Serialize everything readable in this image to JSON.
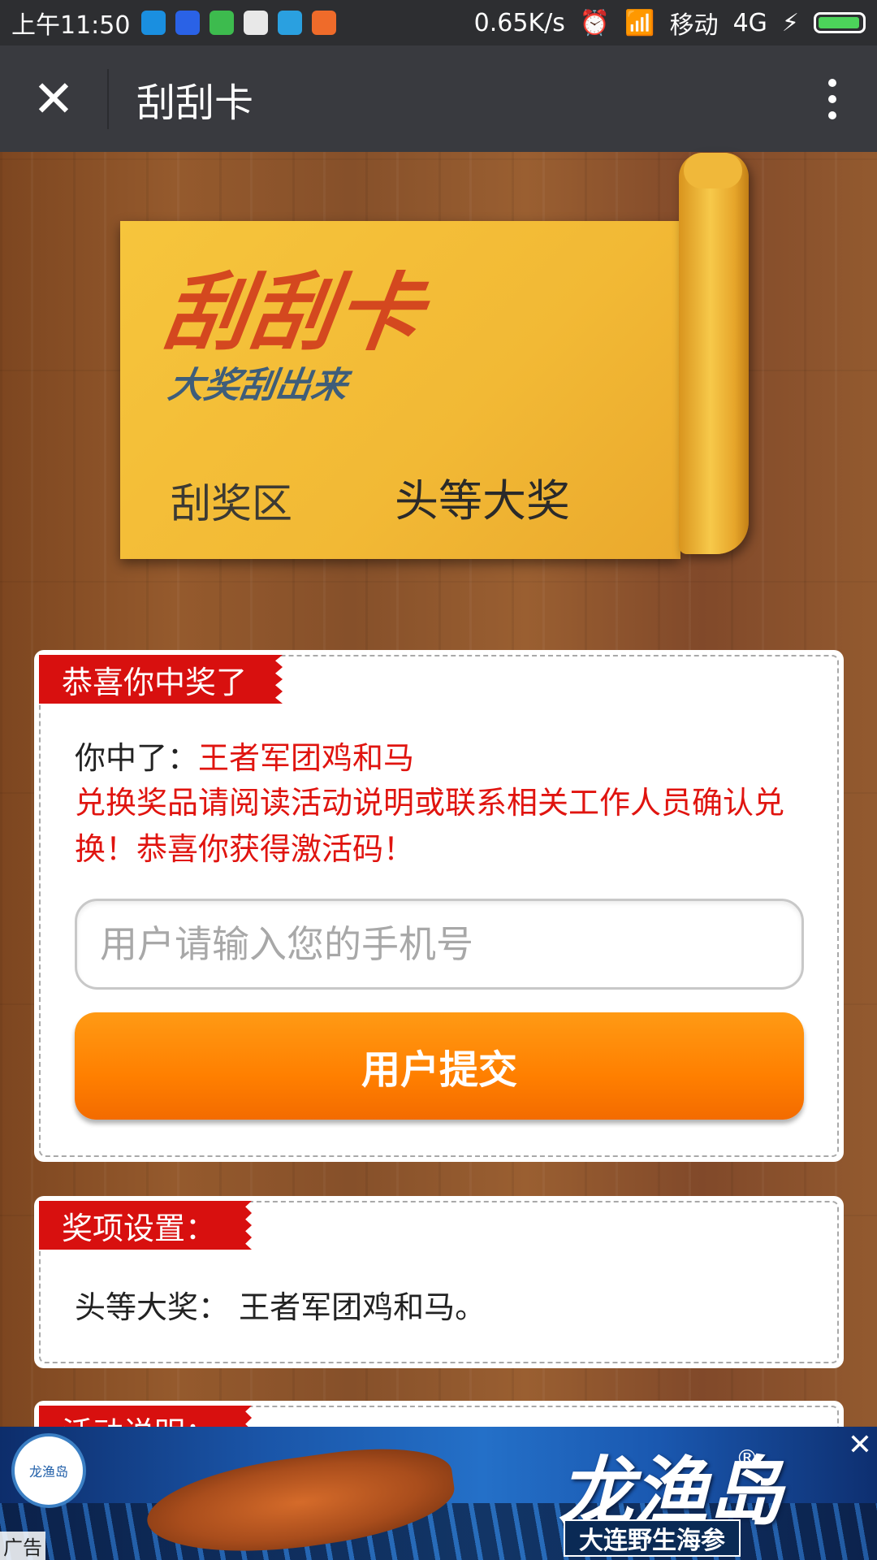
{
  "status_bar": {
    "time": "上午11:50",
    "speed": "0.65K/s",
    "carrier": "移动",
    "network": "4G",
    "app_icon_colors": [
      "#1a8fe0",
      "#2a62e6",
      "#3dbb4e",
      "#e8e8e8",
      "#2aa0e0",
      "#ef6b2a"
    ]
  },
  "title_bar": {
    "close_icon": "close-icon",
    "title": "刮刮卡",
    "more_icon": "more-vertical-icon"
  },
  "banner": {
    "logo_title": "刮刮卡",
    "logo_subtitle": "大奖刮出来",
    "scratch_area_label": "刮奖区",
    "scratch_result": "头等大奖"
  },
  "winner_panel": {
    "ribbon": "恭喜你中奖了",
    "win_prefix": "你中了：",
    "win_prize": "王者军团鸡和马",
    "notice": "兑换奖品请阅读活动说明或联系相关工作人员确认兑换！恭喜你获得激活码！",
    "phone_placeholder": "用户请输入您的手机号",
    "phone_value": "",
    "submit_label": "用户提交"
  },
  "awards_panel": {
    "ribbon": "奖项设置：",
    "award_line": "头等大奖：  王者军团鸡和马。"
  },
  "rules_panel": {
    "ribbon": "活动说明："
  },
  "ad": {
    "badge_text": "龙渔岛",
    "brand": "龙渔岛",
    "registered": "®",
    "slogan": "大连野生海参",
    "close": "✕",
    "label": "广告"
  },
  "colors": {
    "title_bar": "#393a3f",
    "ribbon_red": "#d8100f",
    "prize_red": "#e0140f",
    "submit_orange": "#ff8000",
    "banner_gold": "#f6c53c"
  }
}
